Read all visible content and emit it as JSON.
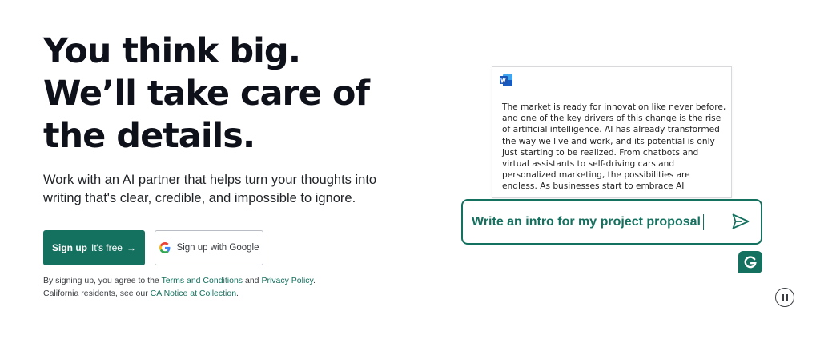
{
  "hero": {
    "title": "You think big. We’ll take care of the details.",
    "subtitle": "Work with an AI partner that helps turn your thoughts into writing that's clear, credible, and impossible to ignore."
  },
  "cta": {
    "signup_label": "Sign up",
    "signup_free": "It's free",
    "signup_arrow": "→",
    "google_label": "Sign up with Google"
  },
  "legal": {
    "prefix": "By signing up, you agree to the",
    "terms": "Terms and Conditions",
    "and": "and",
    "privacy": "Privacy Policy",
    "line2_prefix": "California residents, see our",
    "ca_notice": "CA Notice at Collection"
  },
  "illustration": {
    "doc_text": "The market is ready for innovation like never before, and one of the key drivers of this change is the rise of artificial intelligence. AI has already transformed the way we live and work, and its potential is only just starting to be realized. From chatbots and virtual assistants to self-driving cars and personalized marketing, the possibilities are endless. As businesses start to embrace AI",
    "prompt": "Write an intro for my project proposal",
    "doc_icon": "word-icon",
    "send_icon": "send-icon",
    "badge_icon": "grammarly-g-icon"
  },
  "controls": {
    "pause_icon": "pause-icon"
  },
  "colors": {
    "brand": "#15715f",
    "text": "#0e101a",
    "border": "#b9bcc3"
  }
}
